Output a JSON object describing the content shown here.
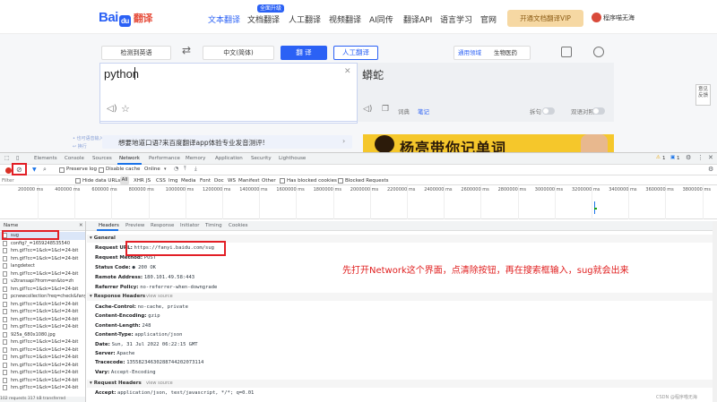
{
  "topnav": {
    "logo_text": "Bai",
    "logo_mark": "du",
    "logo_product": "翻译",
    "items": [
      "文本翻译",
      "文档翻译",
      "人工翻译",
      "视频翻译",
      "AI同传",
      "翻译API",
      "语言学习",
      "官网"
    ],
    "doc_badge": "全面升级",
    "vip_button": "开通文档翻译VIP",
    "user_name": "程序喵无海"
  },
  "translator": {
    "source_lang": "检测到英语",
    "target_lang": "中文(简体)",
    "translate_button": "翻  译",
    "human_button": "人工翻译",
    "domain_label": "通用领域",
    "domain_value": "生物医药",
    "source_text": "python",
    "target_text": "蟒蛇",
    "target_tools": {
      "dict": "词典",
      "note": "笔记",
      "split": "拆句",
      "compare": "双语对照"
    },
    "feedback": "意见\n反馈",
    "hint_line1": "• 也可语音输入",
    "hint_line2": "↩ 换行",
    "app_banner": "想要地道口语?来百度翻译app体验专业发音测评!",
    "ad_text": "杨亮带你记单词"
  },
  "devtools": {
    "tabs": [
      "Elements",
      "Console",
      "Sources",
      "Network",
      "Performance",
      "Memory",
      "Application",
      "Security",
      "Lighthouse"
    ],
    "active_tab": "Network",
    "warn_count": "1",
    "issue_count": "1",
    "toolbar": {
      "preserve_log": "Preserve log",
      "disable_cache": "Disable cache",
      "throttle": "Online"
    },
    "filter_placeholder": "Filter",
    "filter_types": [
      "Hide data URLs",
      "All",
      "XHR",
      "JS",
      "CSS",
      "Img",
      "Media",
      "Font",
      "Doc",
      "WS",
      "Manifest",
      "Other"
    ],
    "has_blocked": "Has blocked cookies",
    "blocked_requests": "Blocked Requests",
    "timeline_ticks": [
      "200000 ms",
      "400000 ms",
      "600000 ms",
      "800000 ms",
      "1000000 ms",
      "1200000 ms",
      "1400000 ms",
      "1600000 ms",
      "1800000 ms",
      "2000000 ms",
      "2200000 ms",
      "2400000 ms",
      "2600000 ms",
      "2800000 ms",
      "3000000 ms",
      "3200000 ms",
      "3400000 ms",
      "3600000 ms",
      "3800000 ms"
    ],
    "req_list_header": "Name",
    "requests": [
      "sug",
      "config?_=1659248535540",
      "hm.gif?cc=1&ck=1&cl=24-bit",
      "hm.gif?cc=1&ck=1&cl=24-bit",
      "langdetect",
      "hm.gif?cc=1&ck=1&cl=24-bit",
      "v2transapi?from=en&to=zh",
      "hm.gif?cc=1&ck=1&cl=24-bit",
      "pcnewcollection?req=check&fanyi",
      "hm.gif?cc=1&ck=1&cl=24-bit",
      "hm.gif?cc=1&ck=1&cl=24-bit",
      "hm.gif?cc=1&ck=1&cl=24-bit",
      "hm.gif?cc=1&ck=1&cl=24-bit",
      "925a_680x1080.jpg",
      "hm.gif?cc=1&ck=1&cl=24-bit",
      "hm.gif?cc=1&ck=1&cl=24-bit",
      "hm.gif?cc=1&ck=1&cl=24-bit",
      "hm.gif?cc=1&ck=1&cl=24-bit",
      "hm.gif?cc=1&ck=1&cl=24-bit",
      "hm.gif?cc=1&ck=1&cl=24-bit",
      "hm.gif?cc=1&ck=1&cl=24-bit"
    ],
    "req_footer": "102 requests  317 kB transferred",
    "detail_tabs": [
      "Headers",
      "Preview",
      "Response",
      "Initiator",
      "Timing",
      "Cookies"
    ],
    "general_title": "General",
    "general": [
      {
        "k": "Request URL:",
        "v": "https://fanyi.baidu.com/sug"
      },
      {
        "k": "Request Method:",
        "v": "POST"
      },
      {
        "k": "Status Code:",
        "v": "● 200 OK"
      },
      {
        "k": "Remote Address:",
        "v": "180.101.49.58:443"
      },
      {
        "k": "Referrer Policy:",
        "v": "no-referrer-when-downgrade"
      }
    ],
    "response_title": "Response Headers",
    "view_source": "view source",
    "response": [
      {
        "k": "Cache-Control:",
        "v": "no-cache, private"
      },
      {
        "k": "Content-Encoding:",
        "v": "gzip"
      },
      {
        "k": "Content-Length:",
        "v": "248"
      },
      {
        "k": "Content-Type:",
        "v": "application/json"
      },
      {
        "k": "Date:",
        "v": "Sun, 31 Jul 2022 06:22:15 GMT"
      },
      {
        "k": "Server:",
        "v": "Apache"
      },
      {
        "k": "Tracecode:",
        "v": "13558234630288744202073114"
      },
      {
        "k": "Vary:",
        "v": "Accept-Encoding"
      }
    ],
    "request_title": "Request Headers",
    "request": [
      {
        "k": "Accept:",
        "v": "application/json, text/javascript, */*; q=0.01"
      }
    ]
  },
  "annotation": "先打开Network这个界面，点清除按钮，再在搜索框输入，sug就会出来",
  "watermark": "CSDN @程序喵无海",
  "colors": {
    "accent": "#2b61f5",
    "annotation_red": "#e02020",
    "devtools_blue": "#1a73e8"
  }
}
